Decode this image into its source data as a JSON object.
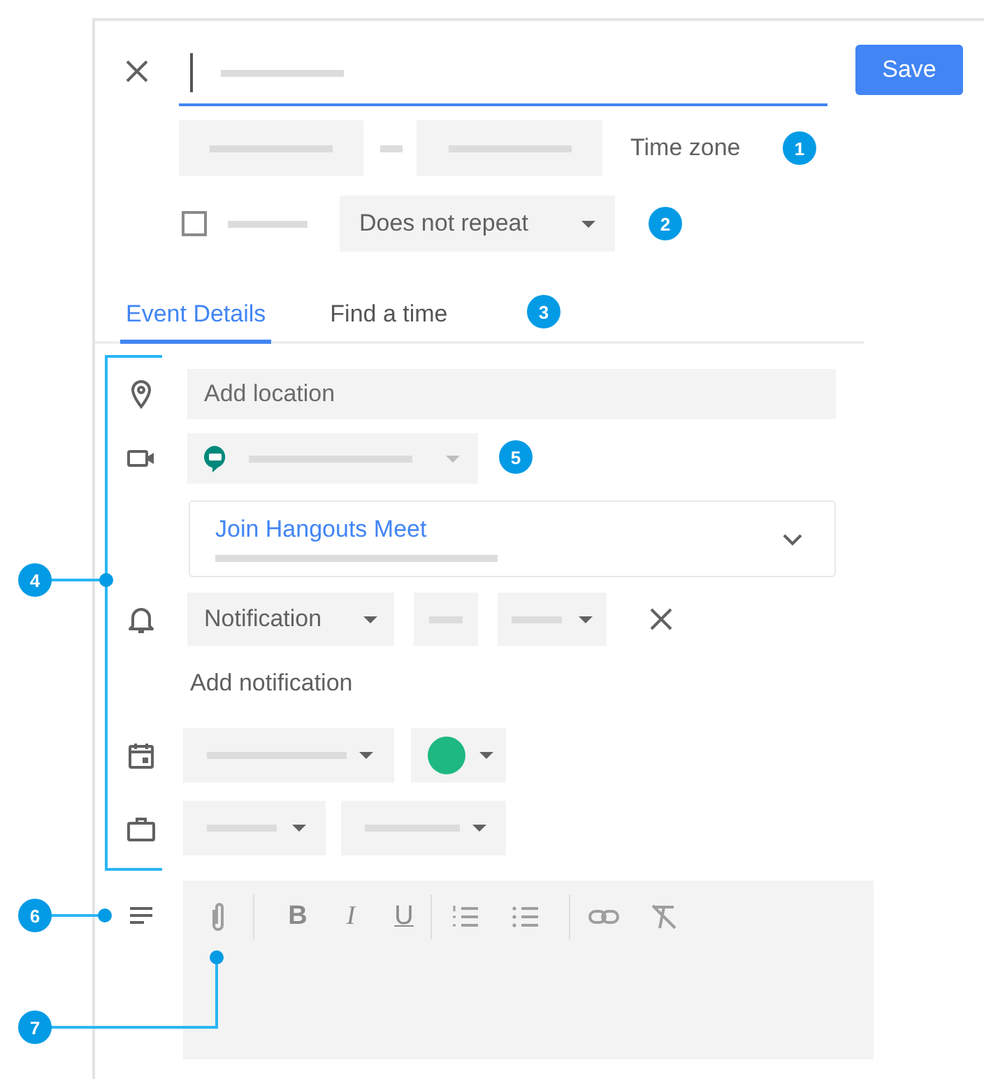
{
  "save_button": {
    "label": "Save"
  },
  "time_row": {
    "time_zone": "Time zone"
  },
  "repeat_row": {
    "all_day": {
      "checked": false
    },
    "repeat": "Does not repeat"
  },
  "tabs": [
    {
      "label": "Event Details",
      "selected": true
    },
    {
      "label": "Find a time",
      "selected": false
    }
  ],
  "location": {
    "placeholder": "Add location"
  },
  "conference": {
    "link": "Join Hangouts Meet"
  },
  "notification": {
    "type": "Notification"
  },
  "add_notification": "Add notification",
  "format_buttons": [
    {
      "kind": "bold",
      "label": "B"
    },
    {
      "kind": "italic",
      "label": "I"
    },
    {
      "kind": "underline",
      "label": "U"
    }
  ],
  "callouts": [
    "1",
    "2",
    "3",
    "4",
    "5",
    "6",
    "7"
  ]
}
